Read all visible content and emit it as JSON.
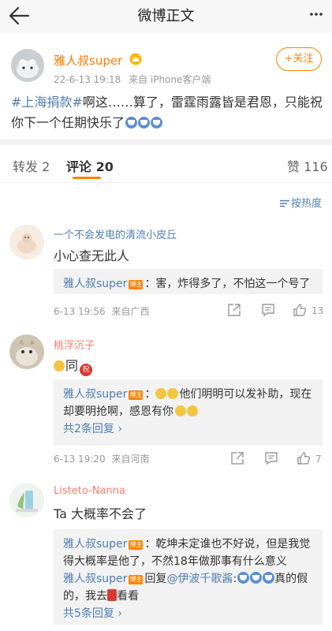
{
  "header": {
    "title": "微博正文"
  },
  "post": {
    "author": "雅人叔super",
    "time": "22-6-13 19:18",
    "source": "来自 iPhone客户端",
    "follow_label": "+关注",
    "topic": "#上海捐款#",
    "text": "啊这……算了，雷霆雨露皆是君恩，只能祝你下一个任期快乐了"
  },
  "tabs": [
    {
      "label": "转发 2"
    },
    {
      "label": "评论 20"
    },
    {
      "label": "赞 116"
    }
  ],
  "sort_label": "按热度",
  "comments": [
    {
      "user": "一个不会发电的清流小皮丘",
      "text": "小心查无此人",
      "replies": [
        {
          "user": "雅人叔super",
          "badge": "博主",
          "text": "：害，炸得多了，不怕这一个号了"
        }
      ],
      "time": "6-13 19:56",
      "location": "来自广西",
      "likes": "13"
    },
    {
      "user": "桃浮沉子",
      "text": "同",
      "replies": [
        {
          "user": "雅人叔super",
          "badge": "博主",
          "text": "他们明明可以发补助，现在却要明抢啊，感恩有你"
        }
      ],
      "more": "共2条回复 ›",
      "time": "6-13 19:20",
      "location": "来自河南",
      "likes": "7"
    },
    {
      "user": "Listeto-Nanna",
      "text": "Ta 大概率不会了",
      "replies": [
        {
          "user": "雅人叔super",
          "badge": "博主",
          "text": "：乾坤未定谁也不好说，但是我觉得大概率是他了，不然18年做那事有什么意义"
        },
        {
          "user": "雅人叔super",
          "badge": "博主",
          "prefix": "回复",
          "mention": "@伊波千歌酱",
          "text": "真的假的，我去",
          "text_end": "看看"
        }
      ],
      "more": "共5条回复 ›"
    }
  ]
}
